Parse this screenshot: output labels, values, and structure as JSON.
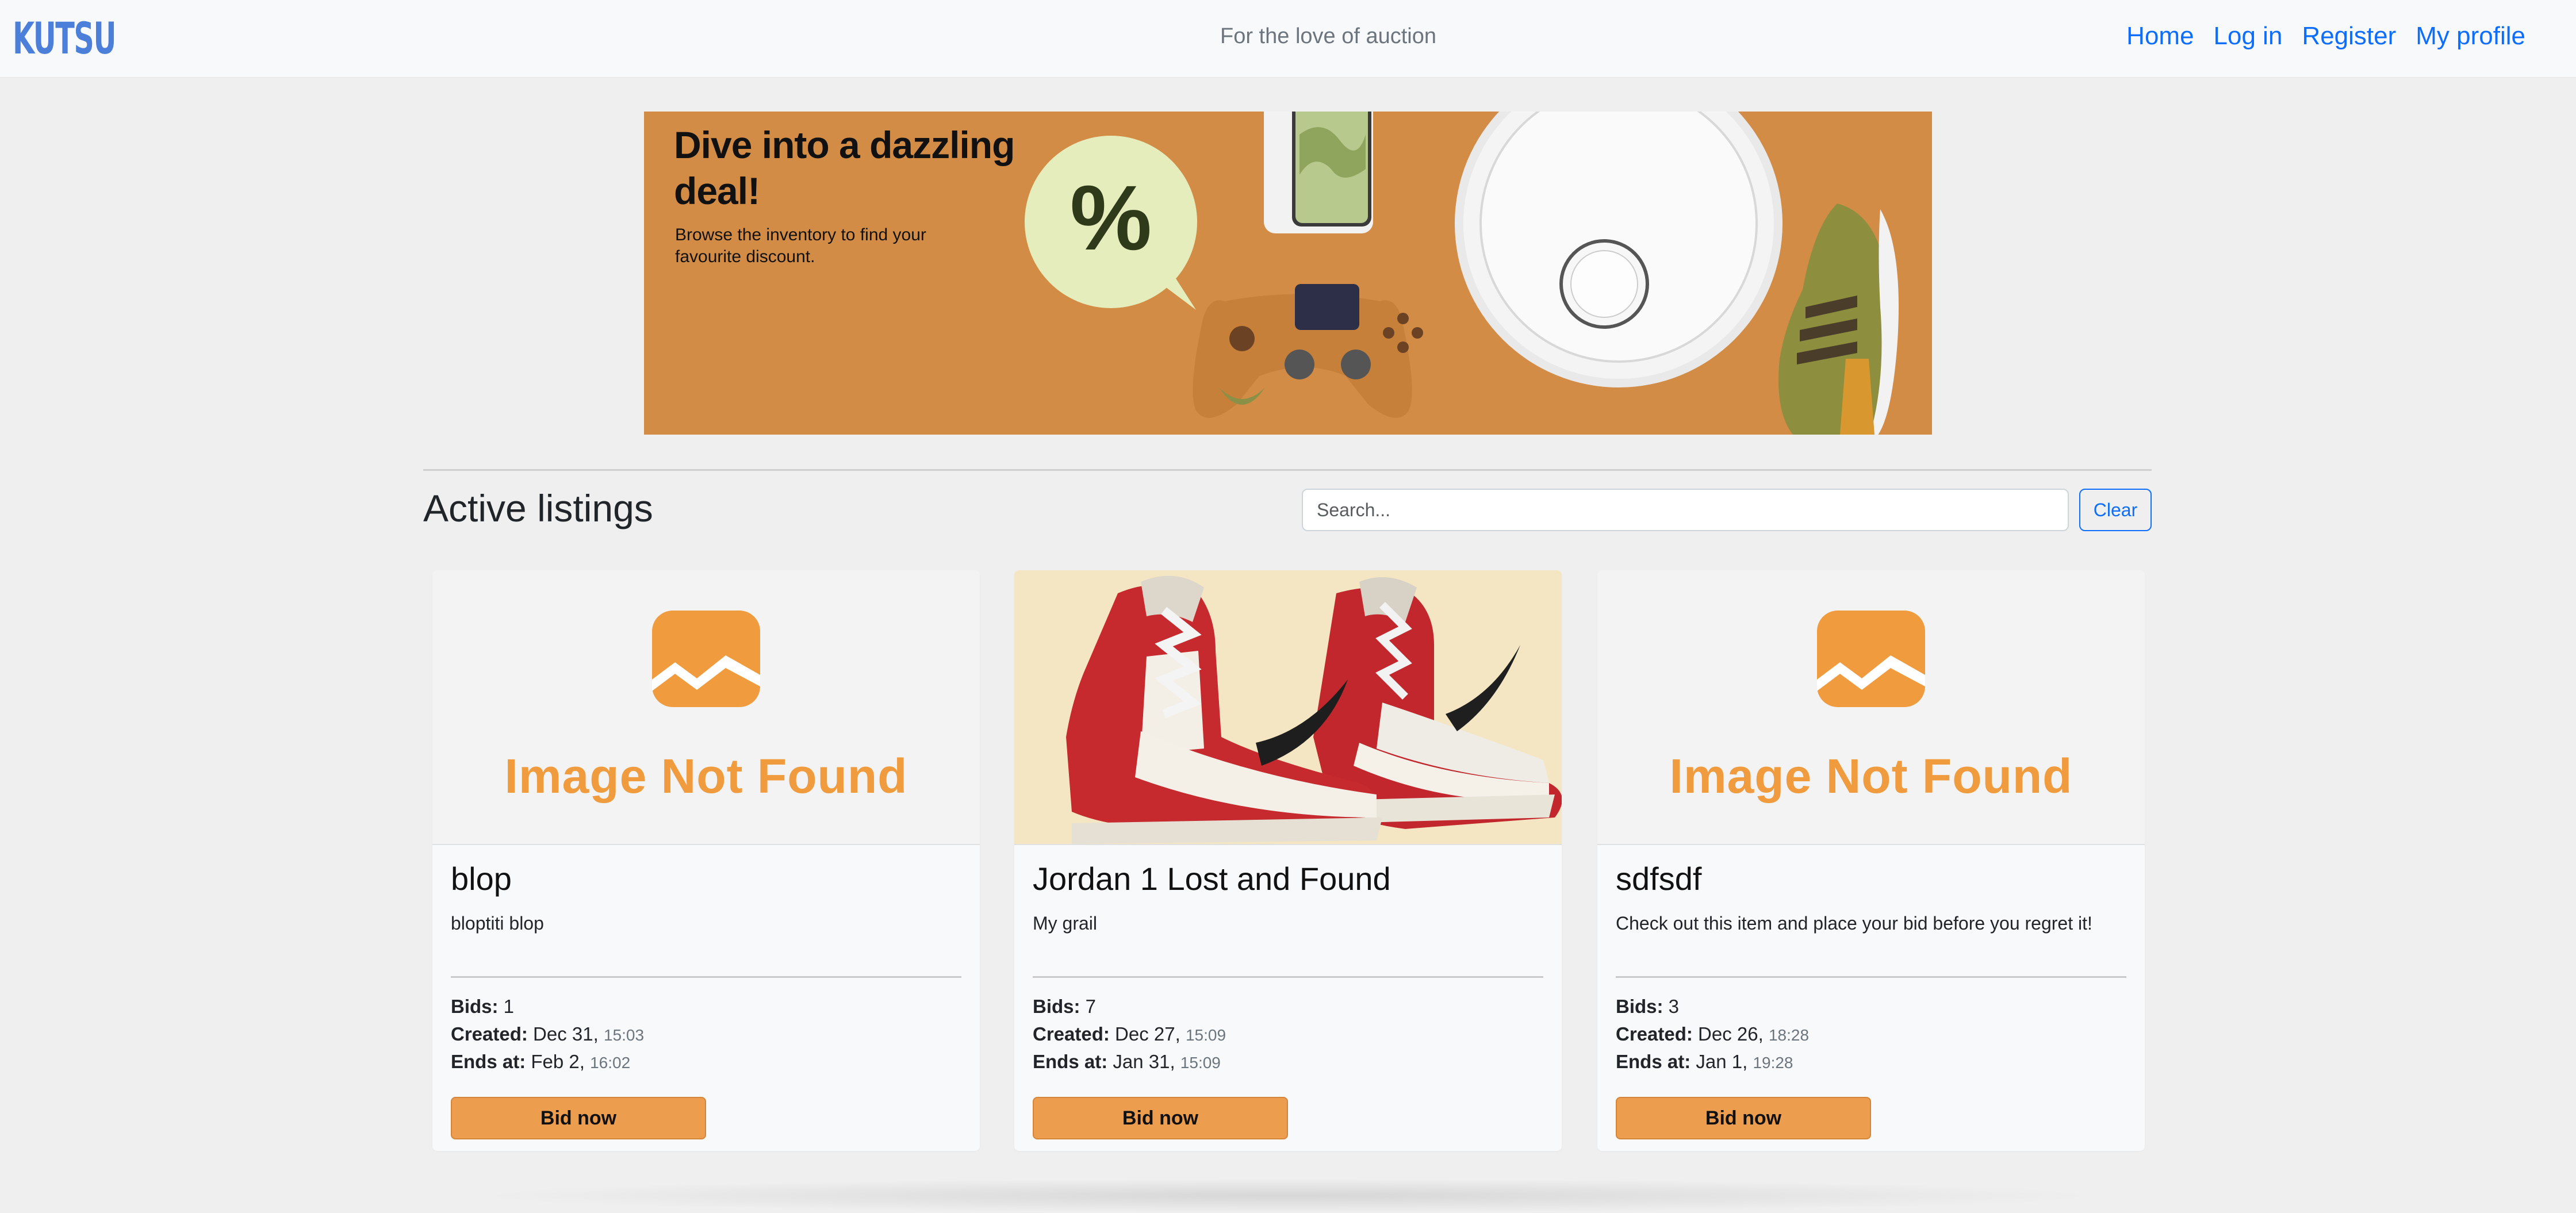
{
  "navbar": {
    "logo": "KUTSU",
    "tagline": "For the love of auction",
    "links": [
      "Home",
      "Log in",
      "Register",
      "My profile"
    ]
  },
  "banner": {
    "headline": "Dive into a dazzling deal!",
    "subtext": "Browse the inventory to find your favourite discount.",
    "badge": "%"
  },
  "listings": {
    "title": "Active listings",
    "search_placeholder": "Search...",
    "clear_label": "Clear",
    "labels": {
      "bids": "Bids:",
      "created": "Created:",
      "ends": "Ends at:"
    },
    "bid_label": "Bid now",
    "image_not_found": "Image Not Found",
    "cards": [
      {
        "title": "blop",
        "description": "bloptiti blop",
        "bids": "1",
        "created_date": "Dec 31",
        "created_time": "15:03",
        "ends_date": "Feb 2",
        "ends_time": "16:02",
        "image": "placeholder"
      },
      {
        "title": "Jordan 1 Lost and Found",
        "description": "My grail",
        "bids": "7",
        "created_date": "Dec 27",
        "created_time": "15:09",
        "ends_date": "Jan 31",
        "ends_time": "15:09",
        "image": "sneakers-photo"
      },
      {
        "title": "sdfsdf",
        "description": "Check out this item and place your bid before you regret it!",
        "bids": "3",
        "created_date": "Dec 26",
        "created_time": "18:28",
        "ends_date": "Jan 1",
        "ends_time": "19:28",
        "image": "placeholder"
      }
    ]
  },
  "colors": {
    "brand": "#4c7fd9",
    "link": "#0d6efd",
    "banner_bg": "#d38c45",
    "bid_button": "#ec9d4e",
    "placeholder_orange": "#ef9b3e"
  }
}
